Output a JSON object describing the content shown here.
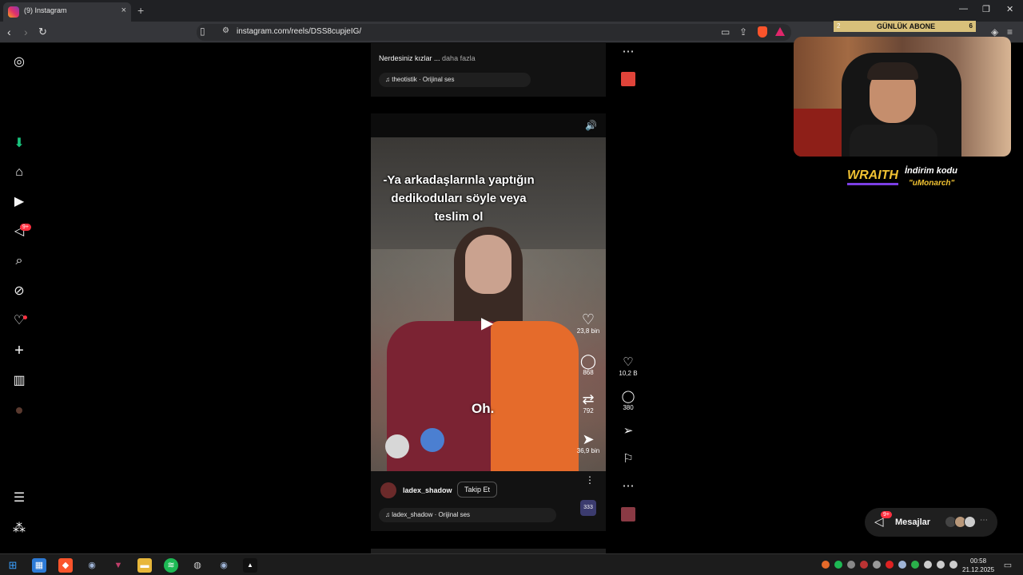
{
  "browser": {
    "tab_title": "(9) Instagram",
    "url": "instagram.com/reels/DSS8cupjeIG/",
    "new_tab": "+",
    "close_tab": "×"
  },
  "sidebar": {
    "notification_badge": "9+"
  },
  "reel_prev": {
    "caption": "Nerdesiniz kızlar ...",
    "more": "daha fazla",
    "audio": "theotistik · Orijinal ses"
  },
  "reel": {
    "caption_line1": "-Ya arkadaşlarınla yaptığın",
    "caption_line2": "dedikoduları söyle veya",
    "caption_line3": "teslim ol",
    "subtitle": "Oh.",
    "username": "ladex_shadow",
    "follow": "Takip Et",
    "audio": "ladex_shadow · Orijinal ses",
    "inner_likes": "23,8 bin",
    "inner_comments": "868",
    "inner_reposts": "792",
    "inner_shares": "36,9 bin",
    "likes": "10,2 B",
    "comments": "380",
    "audio_thumb": "333"
  },
  "stream_overlay": {
    "sub_goal_label": "GÜNLÜK ABONE",
    "sub_goal_current": "2",
    "sub_goal_target": "6",
    "sponsor": "WRAITH",
    "promo_line1": "İndirim kodu",
    "promo_line2": "\"uMonarch\""
  },
  "messages": {
    "label": "Mesajlar",
    "badge": "9+"
  },
  "clock": {
    "time": "00:58",
    "date": "21.12.2025"
  }
}
